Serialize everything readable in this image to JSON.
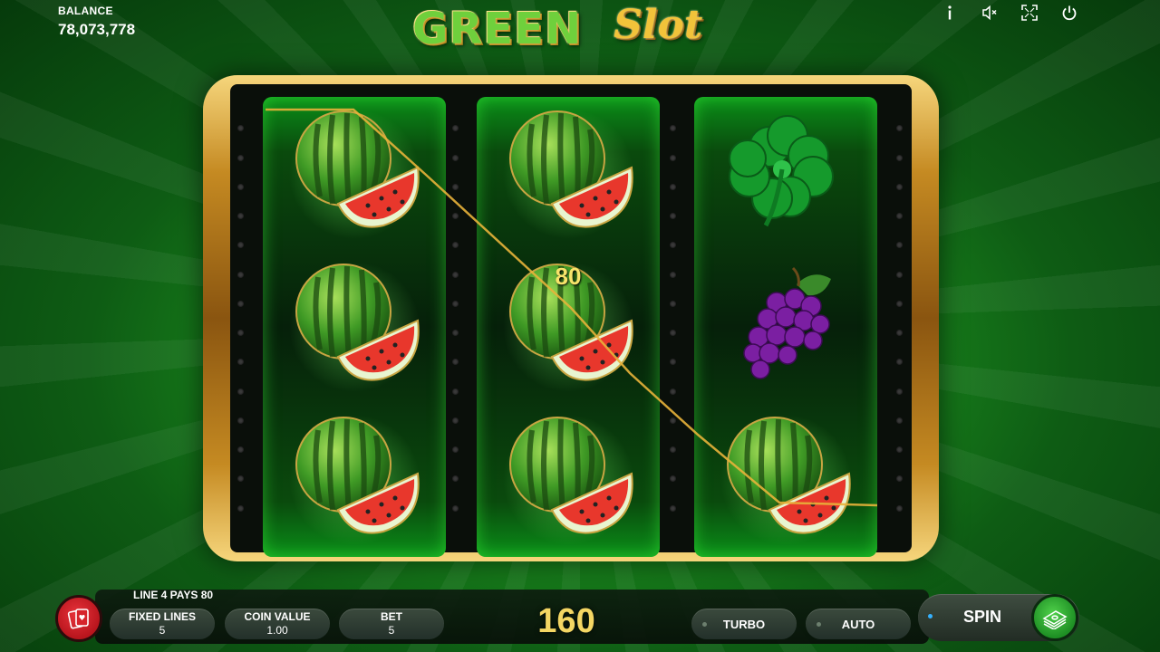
{
  "balance": {
    "label": "BALANCE",
    "value": "78,073,778"
  },
  "logo": {
    "part1": "GREEN",
    "part2": "Slot"
  },
  "top_icons": [
    "info-icon",
    "sound-muted-icon",
    "fullscreen-icon",
    "power-icon"
  ],
  "reels": [
    [
      "watermelon",
      "watermelon",
      "watermelon"
    ],
    [
      "watermelon",
      "watermelon",
      "watermelon"
    ],
    [
      "clover",
      "grapes",
      "watermelon"
    ]
  ],
  "win_symbol_value": "80",
  "bottom": {
    "line_pays": "LINE 4 PAYS 80",
    "fixed_lines": {
      "label": "FIXED LINES",
      "value": "5"
    },
    "coin_value": {
      "label": "COIN VALUE",
      "value": "1.00"
    },
    "bet": {
      "label": "BET",
      "value": "5"
    },
    "win_total": "160",
    "turbo_label": "TURBO",
    "auto_label": "AUTO",
    "spin_label": "SPIN"
  },
  "colors": {
    "payline": "#e8b23a",
    "win_text": "#f4d663",
    "spin_button": "#1e8f24",
    "cards_button": "#b8151d"
  }
}
